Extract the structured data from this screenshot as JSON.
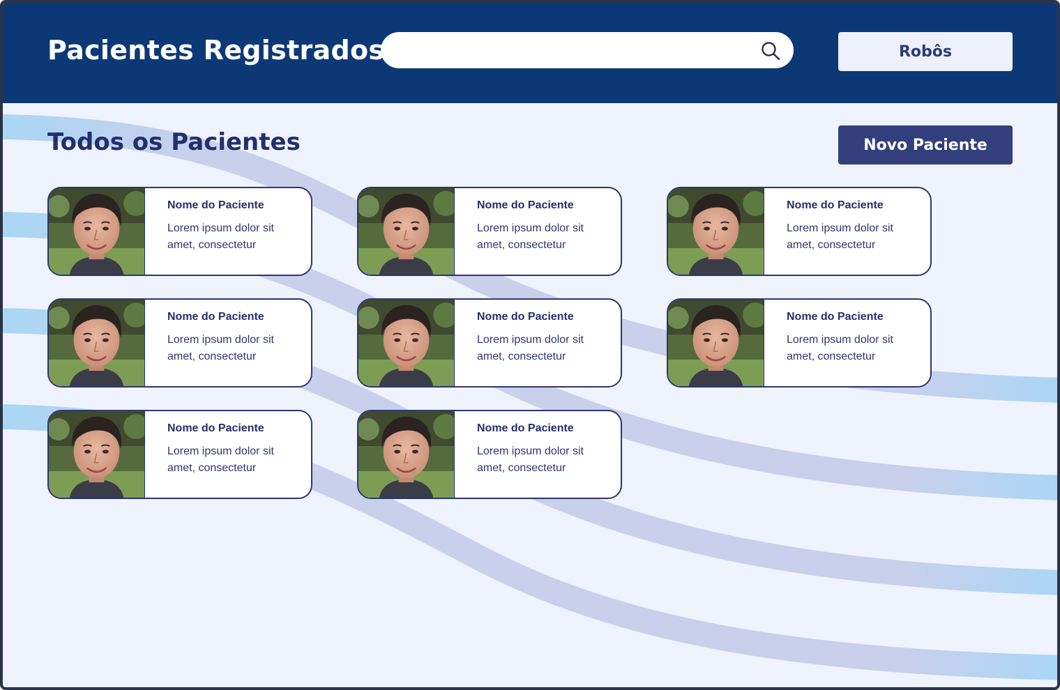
{
  "header": {
    "title": "Pacientes Registrados",
    "search": {
      "value": "",
      "placeholder": ""
    },
    "robots_label": "Robôs"
  },
  "main": {
    "title": "Todos os Pacientes",
    "new_patient_label": "Novo Paciente",
    "patients": [
      {
        "name": "Nome do Paciente",
        "description": "Lorem ipsum dolor sit amet, consectetur"
      },
      {
        "name": "Nome do Paciente",
        "description": "Lorem ipsum dolor sit amet, consectetur"
      },
      {
        "name": "Nome do Paciente",
        "description": "Lorem ipsum dolor sit amet, consectetur"
      },
      {
        "name": "Nome do Paciente",
        "description": "Lorem ipsum dolor sit amet, consectetur"
      },
      {
        "name": "Nome do Paciente",
        "description": "Lorem ipsum dolor sit amet, consectetur"
      },
      {
        "name": "Nome do Paciente",
        "description": "Lorem ipsum dolor sit amet, consectetur"
      },
      {
        "name": "Nome do Paciente",
        "description": "Lorem ipsum dolor sit amet, consectetur"
      },
      {
        "name": "Nome do Paciente",
        "description": "Lorem ipsum dolor sit amet, consectetur"
      }
    ]
  },
  "colors": {
    "header_bg": "#0c3876",
    "page_bg": "#eff3fd",
    "primary_button": "#323f7c",
    "wave_light": "#a9d6f5",
    "wave_muted": "#c9d0ec"
  },
  "icons": {
    "search": "search-icon",
    "avatar": "patient-photo"
  }
}
